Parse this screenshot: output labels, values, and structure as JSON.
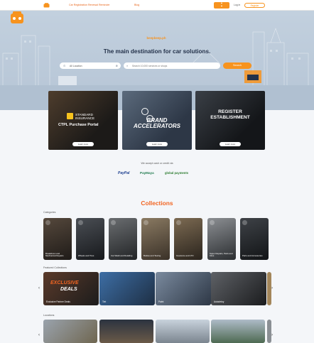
{
  "header": {
    "nav_reminder": "Car Registration Renewal Reminder",
    "nav_blog": "Blog",
    "login": "Log in",
    "register": "Register"
  },
  "hero": {
    "brand": "beepbeep.ph",
    "title": "The main destination for car solutions.",
    "location_value": "All Location",
    "search_placeholder": "Search 10,000 services or shops",
    "search_button": "Search"
  },
  "promos": [
    {
      "line1": "STANDARD",
      "line2": "INSURANCE",
      "line3": "CTPL Purchase Portal",
      "cta": "Learn more"
    },
    {
      "line1": "BRAND",
      "line2": "ACCELERATORS",
      "cta": "Learn more"
    },
    {
      "line1": "REGISTER",
      "line2": "ESTABLISHMENT",
      "cta": "Learn more"
    }
  ],
  "payments": {
    "accept_text": "We accept cash or credit via",
    "paypal": "PayPal",
    "paymaya": "PayMaya",
    "global": "global payments"
  },
  "collections_title": "Collections",
  "categories_label": "Categories",
  "categories": [
    "Breakdown and Mechanical Repairs",
    "Wheels and Tires",
    "Car Wash and Detailing",
    "Bodies and Towing",
    "Insurance and LTO",
    "Super Repairs, Parts and Infos",
    "Parts and Accessories"
  ],
  "featured_label": "Featured Collections",
  "featured": [
    {
      "label": "Exclusive Partner Deals",
      "banner1": "EXCLUSIVE",
      "banner2": "DEALS"
    },
    {
      "label": "Tint"
    },
    {
      "label": "Paint"
    },
    {
      "label": "Autodetoy"
    }
  ],
  "locations_label": "Locations",
  "colors": {
    "accent": "#f7931e",
    "title_orange": "#f26522",
    "hero_bg": "#c2d0de",
    "navy": "#24324a"
  }
}
